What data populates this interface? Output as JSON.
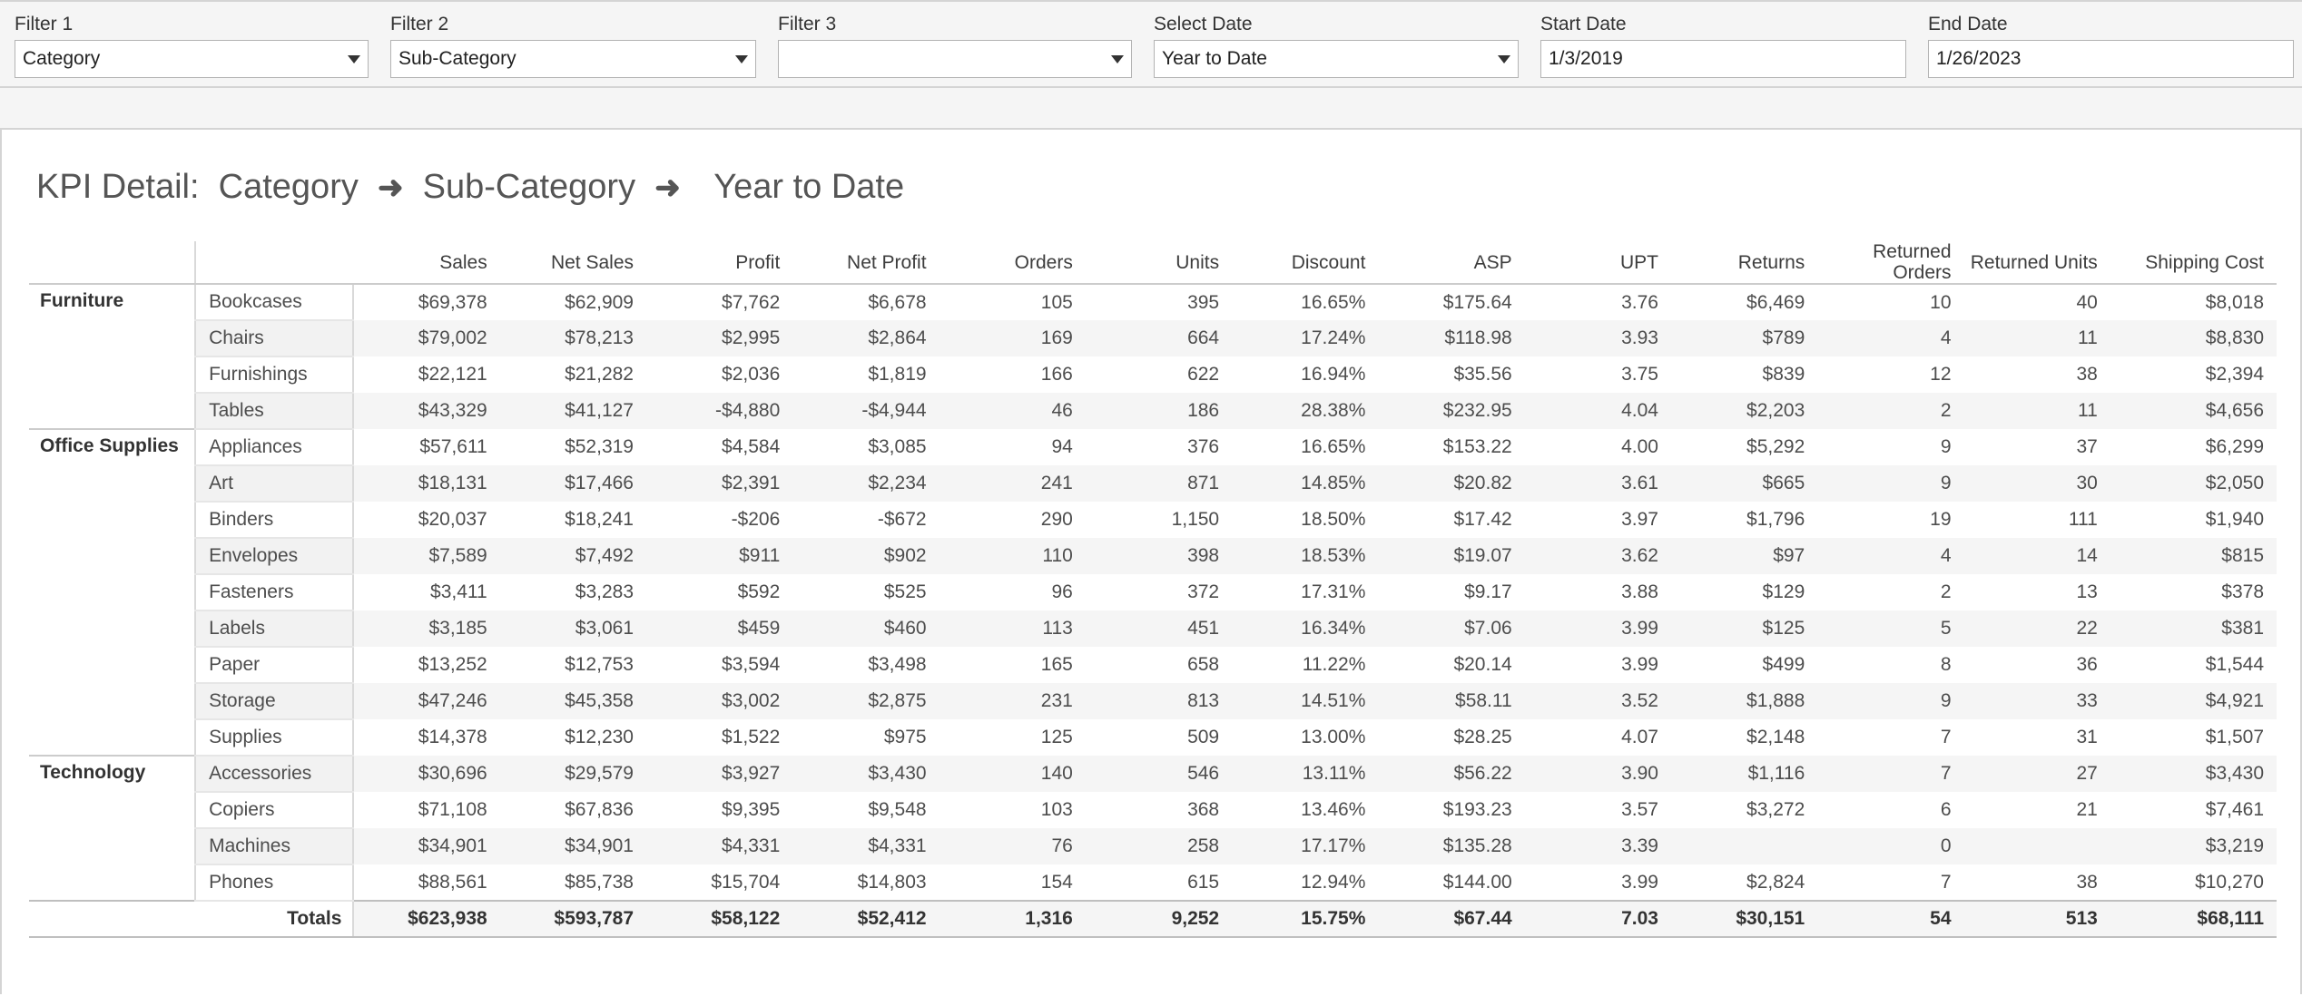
{
  "filters": [
    {
      "label": "Filter 1",
      "value": "Category",
      "name": "filter-1",
      "width": "w-sel-1",
      "type": "select"
    },
    {
      "label": "Filter 2",
      "value": "Sub-Category",
      "name": "filter-2",
      "width": "w-sel-2",
      "type": "select"
    },
    {
      "label": "Filter 3",
      "value": "",
      "name": "filter-3",
      "width": "w-sel-3",
      "type": "select"
    },
    {
      "label": "Select Date",
      "value": "Year to Date",
      "name": "select-date",
      "width": "w-sel-4",
      "type": "select"
    },
    {
      "label": "Start Date",
      "value": "1/3/2019",
      "name": "start-date",
      "width": "w-date",
      "type": "date"
    },
    {
      "label": "End Date",
      "value": "1/26/2023",
      "name": "end-date",
      "width": "w-date",
      "type": "date"
    }
  ],
  "panel": {
    "title_prefix": "KPI Detail:",
    "title_dim1": "Category",
    "title_dim2": "Sub-Category",
    "title_date": "Year to Date",
    "arrow": "➜"
  },
  "table": {
    "columns": [
      {
        "key": "category",
        "label": ""
      },
      {
        "key": "subcategory",
        "label": ""
      },
      {
        "key": "sales",
        "label": "Sales"
      },
      {
        "key": "net_sales",
        "label": "Net Sales"
      },
      {
        "key": "profit",
        "label": "Profit"
      },
      {
        "key": "net_profit",
        "label": "Net Profit"
      },
      {
        "key": "orders",
        "label": "Orders"
      },
      {
        "key": "units",
        "label": "Units"
      },
      {
        "key": "discount",
        "label": "Discount"
      },
      {
        "key": "asp",
        "label": "ASP"
      },
      {
        "key": "upt",
        "label": "UPT"
      },
      {
        "key": "returns",
        "label": "Returns"
      },
      {
        "key": "returned_orders",
        "label": "Returned Orders"
      },
      {
        "key": "returned_units",
        "label": "Returned Units"
      },
      {
        "key": "shipping_cost",
        "label": "Shipping Cost"
      }
    ],
    "groups": [
      {
        "category": "Furniture",
        "rows": [
          {
            "subcategory": "Bookcases",
            "values": [
              "$69,378",
              "$62,909",
              "$7,762",
              "$6,678",
              "105",
              "395",
              "16.65%",
              "$175.64",
              "3.76",
              "$6,469",
              "10",
              "40",
              "$8,018"
            ]
          },
          {
            "subcategory": "Chairs",
            "values": [
              "$79,002",
              "$78,213",
              "$2,995",
              "$2,864",
              "169",
              "664",
              "17.24%",
              "$118.98",
              "3.93",
              "$789",
              "4",
              "11",
              "$8,830"
            ]
          },
          {
            "subcategory": "Furnishings",
            "values": [
              "$22,121",
              "$21,282",
              "$2,036",
              "$1,819",
              "166",
              "622",
              "16.94%",
              "$35.56",
              "3.75",
              "$839",
              "12",
              "38",
              "$2,394"
            ]
          },
          {
            "subcategory": "Tables",
            "values": [
              "$43,329",
              "$41,127",
              "-$4,880",
              "-$4,944",
              "46",
              "186",
              "28.38%",
              "$232.95",
              "4.04",
              "$2,203",
              "2",
              "11",
              "$4,656"
            ]
          }
        ]
      },
      {
        "category": "Office Supplies",
        "rows": [
          {
            "subcategory": "Appliances",
            "values": [
              "$57,611",
              "$52,319",
              "$4,584",
              "$3,085",
              "94",
              "376",
              "16.65%",
              "$153.22",
              "4.00",
              "$5,292",
              "9",
              "37",
              "$6,299"
            ]
          },
          {
            "subcategory": "Art",
            "values": [
              "$18,131",
              "$17,466",
              "$2,391",
              "$2,234",
              "241",
              "871",
              "14.85%",
              "$20.82",
              "3.61",
              "$665",
              "9",
              "30",
              "$2,050"
            ]
          },
          {
            "subcategory": "Binders",
            "values": [
              "$20,037",
              "$18,241",
              "-$206",
              "-$672",
              "290",
              "1,150",
              "18.50%",
              "$17.42",
              "3.97",
              "$1,796",
              "19",
              "111",
              "$1,940"
            ]
          },
          {
            "subcategory": "Envelopes",
            "values": [
              "$7,589",
              "$7,492",
              "$911",
              "$902",
              "110",
              "398",
              "18.53%",
              "$19.07",
              "3.62",
              "$97",
              "4",
              "14",
              "$815"
            ]
          },
          {
            "subcategory": "Fasteners",
            "values": [
              "$3,411",
              "$3,283",
              "$592",
              "$525",
              "96",
              "372",
              "17.31%",
              "$9.17",
              "3.88",
              "$129",
              "2",
              "13",
              "$378"
            ]
          },
          {
            "subcategory": "Labels",
            "values": [
              "$3,185",
              "$3,061",
              "$459",
              "$460",
              "113",
              "451",
              "16.34%",
              "$7.06",
              "3.99",
              "$125",
              "5",
              "22",
              "$381"
            ]
          },
          {
            "subcategory": "Paper",
            "values": [
              "$13,252",
              "$12,753",
              "$3,594",
              "$3,498",
              "165",
              "658",
              "11.22%",
              "$20.14",
              "3.99",
              "$499",
              "8",
              "36",
              "$1,544"
            ]
          },
          {
            "subcategory": "Storage",
            "values": [
              "$47,246",
              "$45,358",
              "$3,002",
              "$2,875",
              "231",
              "813",
              "14.51%",
              "$58.11",
              "3.52",
              "$1,888",
              "9",
              "33",
              "$4,921"
            ]
          },
          {
            "subcategory": "Supplies",
            "values": [
              "$14,378",
              "$12,230",
              "$1,522",
              "$975",
              "125",
              "509",
              "13.00%",
              "$28.25",
              "4.07",
              "$2,148",
              "7",
              "31",
              "$1,507"
            ]
          }
        ]
      },
      {
        "category": "Technology",
        "rows": [
          {
            "subcategory": "Accessories",
            "values": [
              "$30,696",
              "$29,579",
              "$3,927",
              "$3,430",
              "140",
              "546",
              "13.11%",
              "$56.22",
              "3.90",
              "$1,116",
              "7",
              "27",
              "$3,430"
            ]
          },
          {
            "subcategory": "Copiers",
            "values": [
              "$71,108",
              "$67,836",
              "$9,395",
              "$9,548",
              "103",
              "368",
              "13.46%",
              "$193.23",
              "3.57",
              "$3,272",
              "6",
              "21",
              "$7,461"
            ]
          },
          {
            "subcategory": "Machines",
            "values": [
              "$34,901",
              "$34,901",
              "$4,331",
              "$4,331",
              "76",
              "258",
              "17.17%",
              "$135.28",
              "3.39",
              "",
              "0",
              "",
              "$3,219"
            ]
          },
          {
            "subcategory": "Phones",
            "values": [
              "$88,561",
              "$85,738",
              "$15,704",
              "$14,803",
              "154",
              "615",
              "12.94%",
              "$144.00",
              "3.99",
              "$2,824",
              "7",
              "38",
              "$10,270"
            ]
          }
        ]
      }
    ],
    "totals": {
      "label": "Totals",
      "values": [
        "$623,938",
        "$593,787",
        "$58,122",
        "$52,412",
        "1,316",
        "9,252",
        "15.75%",
        "$67.44",
        "7.03",
        "$30,151",
        "54",
        "513",
        "$68,111"
      ]
    }
  }
}
